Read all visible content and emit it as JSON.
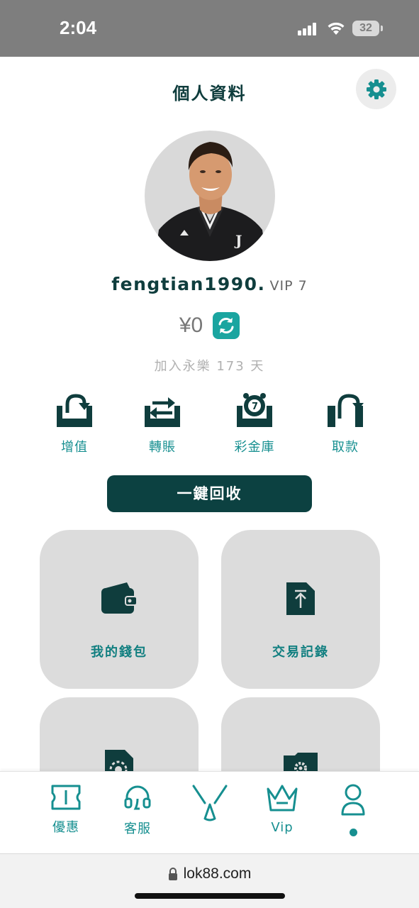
{
  "status_bar": {
    "time": "2:04",
    "battery": "32"
  },
  "header": {
    "title": "個人資料"
  },
  "profile": {
    "username": "fengtian1990.",
    "vip_level": "VIP 7",
    "balance": "¥0",
    "joined_text": "加入永樂 173 天"
  },
  "actions": [
    {
      "label": "增值",
      "icon": "deposit-icon"
    },
    {
      "label": "轉賬",
      "icon": "transfer-icon"
    },
    {
      "label": "彩金庫",
      "icon": "bonus-vault-icon"
    },
    {
      "label": "取款",
      "icon": "withdraw-icon"
    }
  ],
  "reclaim_button": "一鍵回收",
  "cards": [
    {
      "label": "我的錢包",
      "icon": "wallet-icon"
    },
    {
      "label": "交易記錄",
      "icon": "transaction-record-icon"
    },
    {
      "label": "",
      "icon": "betting-record-icon"
    },
    {
      "label": "",
      "icon": "settings-folder-icon"
    }
  ],
  "bottom_nav": [
    {
      "label": "優惠",
      "icon": "ticket-icon"
    },
    {
      "label": "客服",
      "icon": "headset-icon"
    },
    {
      "label": "",
      "icon": "brand-logo-icon"
    },
    {
      "label": "Vip",
      "icon": "crown-icon"
    },
    {
      "label": "",
      "icon": "profile-icon",
      "active": true
    }
  ],
  "browser": {
    "url": "lok88.com"
  },
  "colors": {
    "primary_dark": "#0c4141",
    "accent": "#168f90",
    "card_bg": "#dcdcdc"
  }
}
